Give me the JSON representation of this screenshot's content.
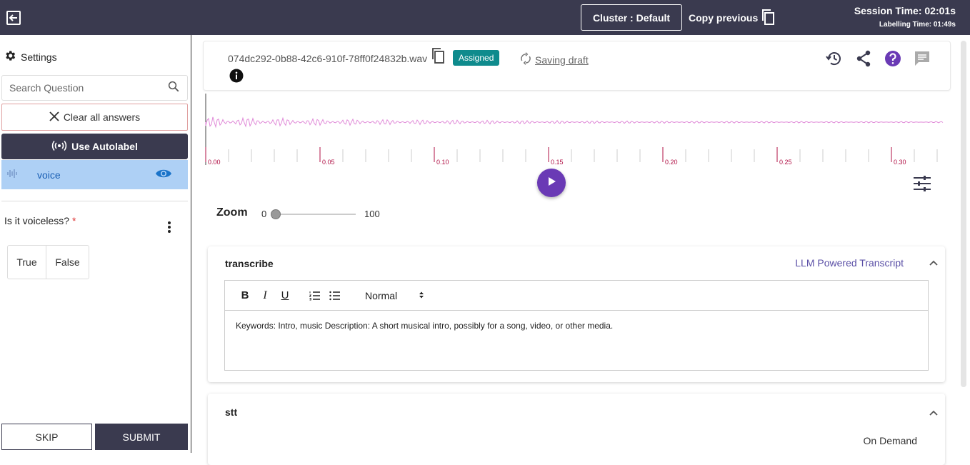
{
  "topbar": {
    "cluster_label": "Cluster : Default",
    "copy_previous_label": "Copy previous",
    "session_time": "Session Time: 02:01s",
    "labelling_time": "Labelling Time: 01:49s"
  },
  "sidebar": {
    "settings_label": "Settings",
    "search_placeholder": "Search Question",
    "clear_label": "Clear all answers",
    "autolabel_label": "Use Autolabel",
    "voice_label": "voice",
    "question_label": "Is it voiceless?",
    "required_mark": "*",
    "options": [
      "True",
      "False"
    ],
    "skip_label": "SKIP",
    "submit_label": "SUBMIT"
  },
  "file": {
    "name": "074dc292-0b88-42c6-910f-78ff0f24832b.wav",
    "status_badge": "Assigned",
    "saving_label": "Saving draft"
  },
  "waveform": {
    "tick_labels": [
      "0.00",
      "0.05",
      "0.10",
      "0.15",
      "0.20",
      "0.25",
      "0.30"
    ],
    "wave_color": "#e08ad8",
    "tick_color": "#b01045"
  },
  "zoom": {
    "label": "Zoom",
    "min": "0",
    "max": "100",
    "value": 0
  },
  "panels": {
    "transcribe": {
      "title": "transcribe",
      "link_label": "LLM Powered Transcript",
      "format_label": "Normal",
      "text": "Keywords: Intro, music Description: A short musical intro, possibly for a song, video, or other media."
    },
    "stt": {
      "title": "stt",
      "mode_label": "On Demand"
    }
  },
  "colors": {
    "topbar_bg": "#3a3a4f",
    "badge": "#0f8b8d",
    "accent_purple": "#6a3ab5",
    "selected_item_bg": "#aed0f5"
  }
}
